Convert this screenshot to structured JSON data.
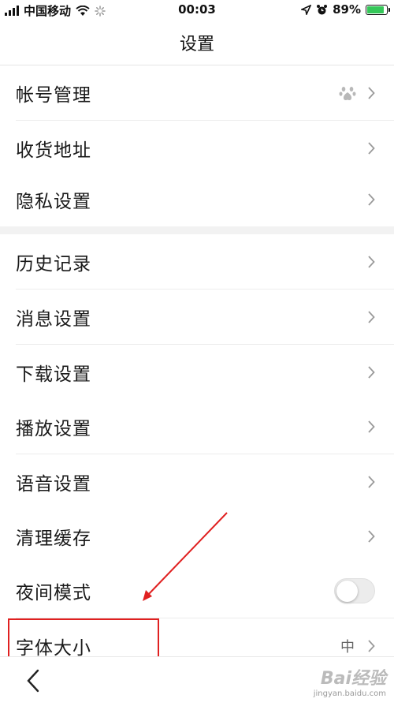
{
  "status_bar": {
    "carrier": "中国移动",
    "time": "00:03",
    "battery_percent": "89%",
    "battery_level": 0.89
  },
  "header": {
    "title": "设置"
  },
  "settings_groups": [
    {
      "items": [
        {
          "label": "帐号管理",
          "icon": "baidu-paw-icon"
        },
        {
          "label": "收货地址"
        },
        {
          "label": "隐私设置"
        }
      ]
    },
    {
      "items": [
        {
          "label": "历史记录"
        },
        {
          "label": "消息设置"
        },
        {
          "label": "下载设置"
        },
        {
          "label": "播放设置"
        },
        {
          "label": "语音设置"
        },
        {
          "label": "清理缓存"
        },
        {
          "label": "夜间模式",
          "toggle": false
        },
        {
          "label": "字体大小",
          "value": "中"
        }
      ]
    }
  ],
  "watermark": {
    "logo": "Bai经验",
    "url": "jingyan.baidu.com"
  },
  "colors": {
    "annotation": "#e02020",
    "battery": "#35c759"
  }
}
